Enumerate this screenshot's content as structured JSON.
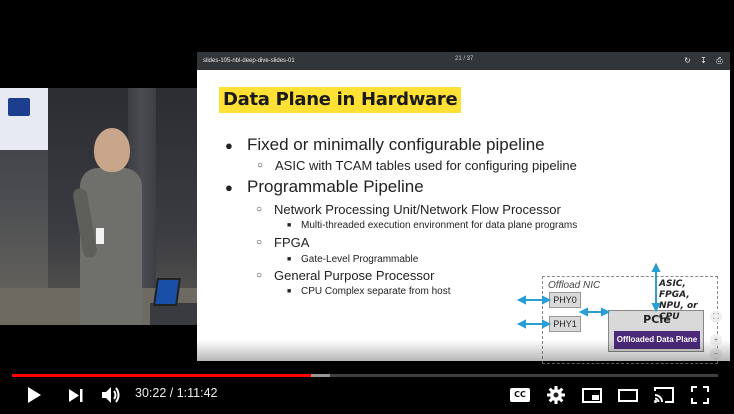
{
  "player": {
    "current_time": "30:22",
    "separator": " / ",
    "duration": "1:11:42",
    "progress_fraction": 0.423,
    "buffered_fraction": 0.451,
    "cc_label": "CC"
  },
  "pdf_viewer": {
    "filename": "slides-105-nbl-deep-dive-slides-01",
    "page_indicator": "21 / 37"
  },
  "slide": {
    "title": "Data Plane in Hardware",
    "bullets": [
      {
        "level": 1,
        "text": "Fixed or minimally configurable pipeline"
      },
      {
        "level": 2,
        "text": "ASIC with TCAM tables used for configuring pipeline"
      },
      {
        "level": 1,
        "text": "Programmable Pipeline"
      },
      {
        "level": 2,
        "text": "Network Processing Unit/Network Flow Processor"
      },
      {
        "level": 3,
        "text": "Multi-threaded execution environment for data plane programs"
      },
      {
        "level": 2,
        "text": "FPGA"
      },
      {
        "level": 3,
        "text": "Gate-Level Programmable"
      },
      {
        "level": 2,
        "text": "General Purpose Processor"
      },
      {
        "level": 3,
        "text": "CPU Complex separate from host"
      }
    ],
    "diagram": {
      "nic_label": "Offload NIC",
      "phy0": "PHY0",
      "phy1": "PHY1",
      "pcie": "PCIe",
      "offloaded": "Offloaded Data Plane",
      "asic_label": "ASIC, FPGA, NPU, or CPU"
    }
  },
  "colors": {
    "progress_played": "#ff0000",
    "title_highlight": "#ffe135",
    "offload_box": "#4b2a7a",
    "arrow": "#2a9fd6"
  }
}
